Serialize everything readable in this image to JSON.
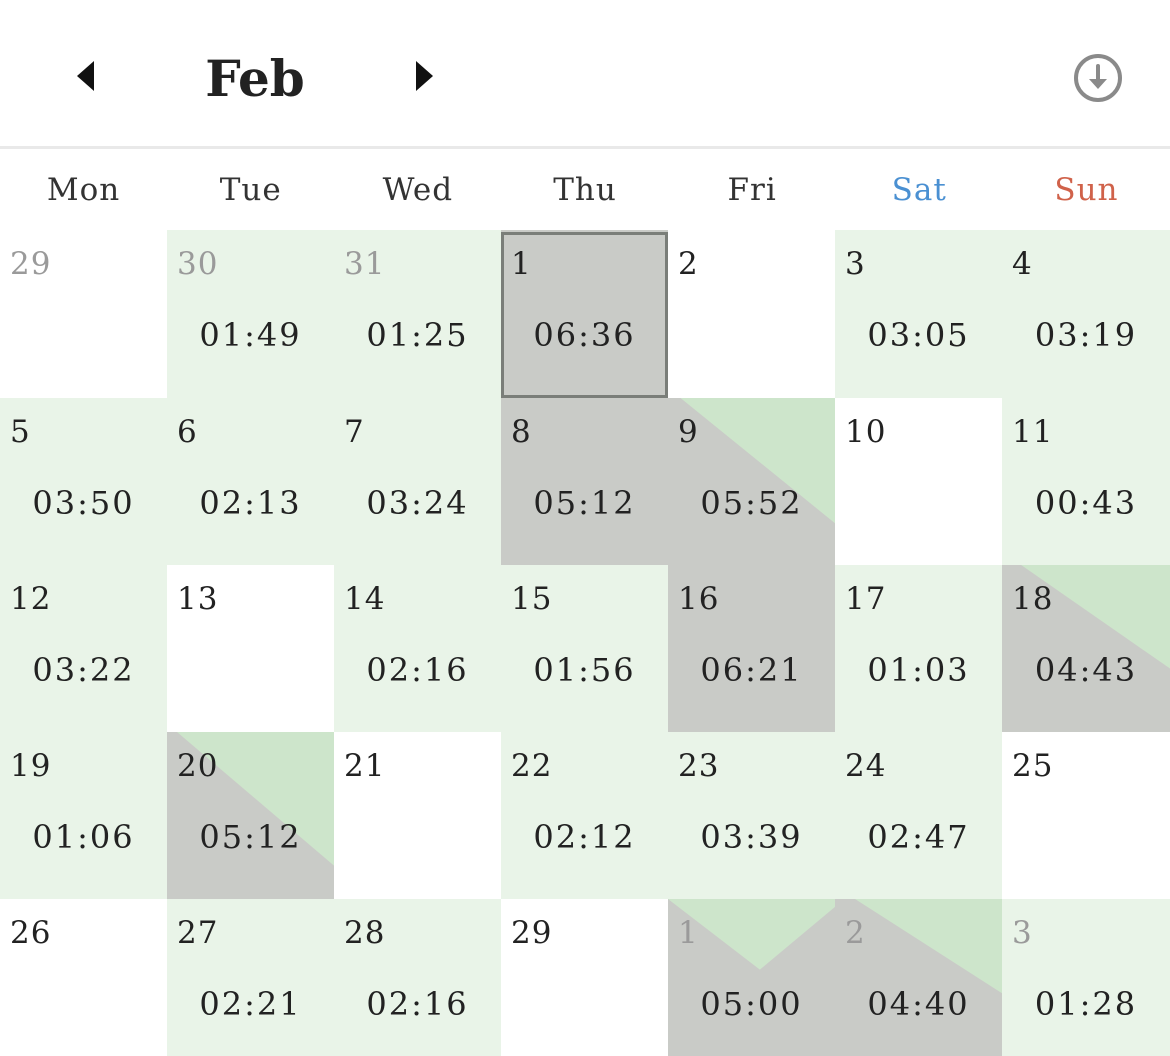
{
  "header": {
    "month": "Feb",
    "prev_icon": "triangle-left-icon",
    "next_icon": "triangle-right-icon",
    "download_icon": "circle-arrow-down-icon"
  },
  "colors": {
    "text": "#222222",
    "muted": "#9a9a9a",
    "light_green": "#e9f4e8",
    "mid_green": "#cde5cb",
    "gray": "#c9cbc7",
    "sat": "#4a90d2",
    "sun": "#d0624a",
    "today_border": "#7a7e79"
  },
  "weekdays": [
    {
      "label": "Mon",
      "style": "normal"
    },
    {
      "label": "Tue",
      "style": "normal"
    },
    {
      "label": "Wed",
      "style": "normal"
    },
    {
      "label": "Thu",
      "style": "normal"
    },
    {
      "label": "Fri",
      "style": "normal"
    },
    {
      "label": "Sat",
      "style": "sat"
    },
    {
      "label": "Sun",
      "style": "sun"
    }
  ],
  "weeks": [
    [
      {
        "day": "29",
        "muted": true,
        "time": "",
        "fill": "none",
        "level": 0
      },
      {
        "day": "30",
        "muted": true,
        "time": "01:49",
        "fill": "light",
        "level": 0
      },
      {
        "day": "31",
        "muted": true,
        "time": "01:25",
        "fill": "light",
        "level": 0
      },
      {
        "day": "1",
        "muted": false,
        "time": "06:36",
        "fill": "gray",
        "level": 1,
        "today": true
      },
      {
        "day": "2",
        "muted": false,
        "time": "",
        "fill": "none",
        "level": 0
      },
      {
        "day": "3",
        "muted": false,
        "time": "03:05",
        "fill": "light",
        "level": 0
      },
      {
        "day": "4",
        "muted": false,
        "time": "03:19",
        "fill": "light",
        "level": 0
      }
    ],
    [
      {
        "day": "5",
        "muted": false,
        "time": "03:50",
        "fill": "light",
        "level": 0
      },
      {
        "day": "6",
        "muted": false,
        "time": "02:13",
        "fill": "light",
        "level": 0
      },
      {
        "day": "7",
        "muted": false,
        "time": "03:24",
        "fill": "light",
        "level": 0
      },
      {
        "day": "8",
        "muted": false,
        "time": "05:12",
        "fill": "gray",
        "level": 1
      },
      {
        "day": "9",
        "muted": false,
        "time": "05:52",
        "fill": "diag",
        "level": 0.75
      },
      {
        "day": "10",
        "muted": false,
        "time": "",
        "fill": "none",
        "level": 0
      },
      {
        "day": "11",
        "muted": false,
        "time": "00:43",
        "fill": "light",
        "level": 0
      }
    ],
    [
      {
        "day": "12",
        "muted": false,
        "time": "03:22",
        "fill": "light",
        "level": 0
      },
      {
        "day": "13",
        "muted": false,
        "time": "",
        "fill": "none",
        "level": 0
      },
      {
        "day": "14",
        "muted": false,
        "time": "02:16",
        "fill": "light",
        "level": 0
      },
      {
        "day": "15",
        "muted": false,
        "time": "01:56",
        "fill": "light",
        "level": 0
      },
      {
        "day": "16",
        "muted": false,
        "time": "06:21",
        "fill": "gray",
        "level": 1
      },
      {
        "day": "17",
        "muted": false,
        "time": "01:03",
        "fill": "light",
        "level": 0
      },
      {
        "day": "18",
        "muted": false,
        "time": "04:43",
        "fill": "diag",
        "level": 0.62
      }
    ],
    [
      {
        "day": "19",
        "muted": false,
        "time": "01:06",
        "fill": "light",
        "level": 0
      },
      {
        "day": "20",
        "muted": false,
        "time": "05:12",
        "fill": "diag",
        "level": 0.8
      },
      {
        "day": "21",
        "muted": false,
        "time": "",
        "fill": "none",
        "level": 0
      },
      {
        "day": "22",
        "muted": false,
        "time": "02:12",
        "fill": "light",
        "level": 0
      },
      {
        "day": "23",
        "muted": false,
        "time": "03:39",
        "fill": "light",
        "level": 0
      },
      {
        "day": "24",
        "muted": false,
        "time": "02:47",
        "fill": "light",
        "level": 0
      },
      {
        "day": "25",
        "muted": false,
        "time": "",
        "fill": "none",
        "level": 0
      }
    ],
    [
      {
        "day": "26",
        "muted": false,
        "time": "",
        "fill": "none",
        "level": 0
      },
      {
        "day": "27",
        "muted": false,
        "time": "02:21",
        "fill": "light",
        "level": 0
      },
      {
        "day": "28",
        "muted": false,
        "time": "02:16",
        "fill": "light",
        "level": 0
      },
      {
        "day": "29",
        "muted": false,
        "time": "",
        "fill": "none",
        "level": 0
      },
      {
        "day": "1",
        "muted": true,
        "time": "05:00",
        "fill": "diag-left",
        "level": 0.6
      },
      {
        "day": "2",
        "muted": true,
        "time": "04:40",
        "fill": "diag",
        "level": 0.6
      },
      {
        "day": "3",
        "muted": true,
        "time": "01:28",
        "fill": "light",
        "level": 0
      }
    ]
  ]
}
